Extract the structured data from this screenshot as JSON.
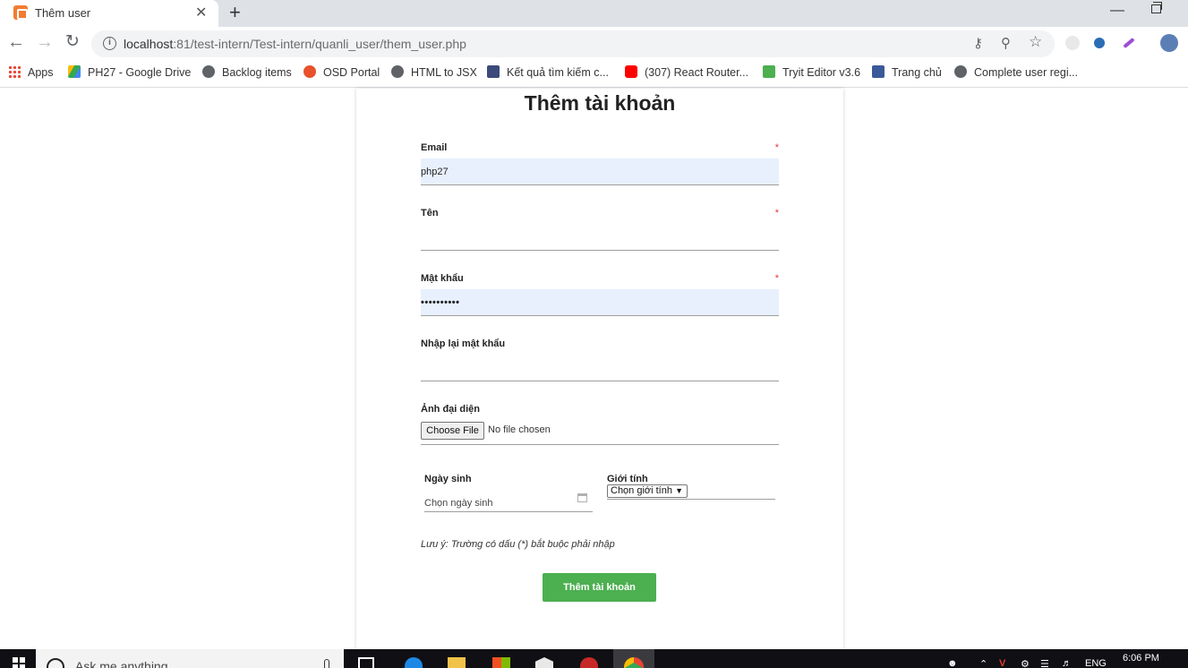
{
  "browser": {
    "tab_title": "Thêm user",
    "tab_close": "✕",
    "new_tab": "+",
    "win_minimize": "—",
    "url_host": "localhost",
    "url_rest": ":81/test-intern/Test-intern/quanli_user/them_user.php"
  },
  "bookmarks": [
    {
      "label": "Apps",
      "icon": "apps-grid-icon"
    },
    {
      "label": "PH27 - Google Drive",
      "icon": "google-drive-icon"
    },
    {
      "label": "Backlog items",
      "icon": "globe-icon"
    },
    {
      "label": "OSD Portal",
      "icon": "osd-icon"
    },
    {
      "label": "HTML to JSX",
      "icon": "globe-icon"
    },
    {
      "label": "Kết quả tìm kiếm c...",
      "icon": "shield-icon"
    },
    {
      "label": "(307) React Router...",
      "icon": "youtube-icon"
    },
    {
      "label": "Tryit Editor v3.6",
      "icon": "w3schools-icon"
    },
    {
      "label": "Trang chủ",
      "icon": "facebook-icon"
    },
    {
      "label": "Complete user regi...",
      "icon": "globe-icon"
    }
  ],
  "form": {
    "title": "Thêm tài khoản",
    "required_mark": "*",
    "email_label": "Email",
    "email_value": "php27",
    "name_label": "Tên",
    "name_value": "",
    "password_label": "Mật khẩu",
    "password_value": "••••••••••",
    "confirm_label": "Nhập lại mật khẩu",
    "confirm_value": "",
    "avatar_label": "Ảnh đại diện",
    "file_button": "Choose File",
    "file_status": "No file chosen",
    "birthday_label": "Ngày sinh",
    "birthday_placeholder": "Chọn ngày sinh",
    "gender_label": "Giới tính",
    "gender_selected": "Chọn giới tính",
    "note": "Lưu ý: Trường có dấu (*) bắt buộc phải nhập",
    "submit_label": "Thêm tài khoản"
  },
  "taskbar": {
    "search_text": "Ask me anything",
    "language": "ENG",
    "time": "6:06 PM"
  },
  "colors": {
    "submit_green": "#4caf50",
    "autofill_blue": "#e8f0fe",
    "required_red": "#e53935"
  }
}
